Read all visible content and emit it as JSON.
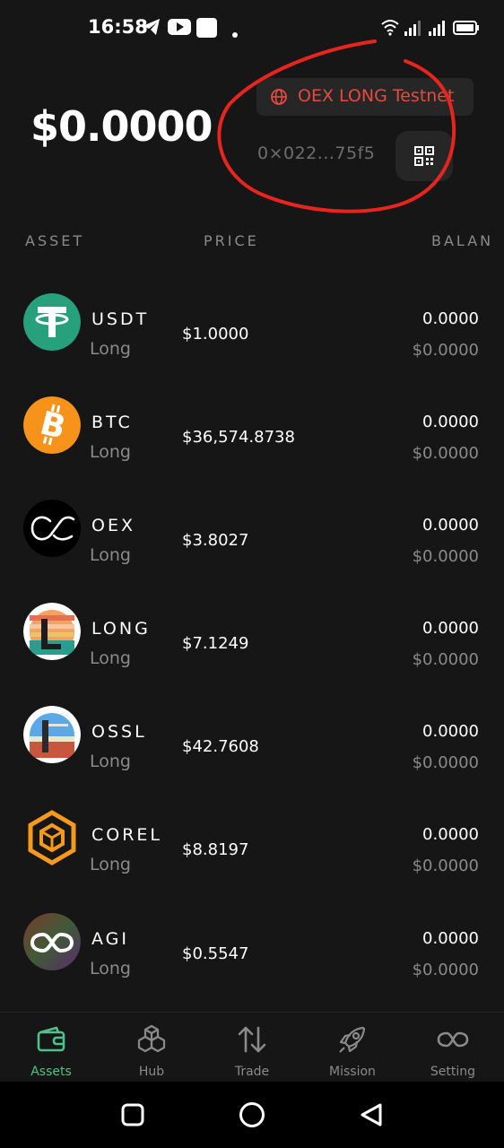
{
  "status_bar": {
    "time": "16:58",
    "icons": [
      "telegram-icon",
      "youtube-icon",
      "app-icon",
      "dot-icon",
      "wifi-icon",
      "signal-icon",
      "signal-icon",
      "battery-icon"
    ]
  },
  "header": {
    "total_balance": "$0.0000",
    "network_label": "OEX LONG Testnet",
    "address": "0×022...75f5",
    "accent_color": "#e8493f"
  },
  "table": {
    "columns": [
      "ASSET",
      "PRICE",
      "BALAN"
    ]
  },
  "assets": [
    {
      "symbol": "USDT",
      "network": "Long",
      "price": "$1.0000",
      "balance": "0.0000",
      "balance_usd": "$0.0000",
      "icon": "usdt-icon"
    },
    {
      "symbol": "BTC",
      "network": "Long",
      "price": "$36,574.8738",
      "balance": "0.0000",
      "balance_usd": "$0.0000",
      "icon": "btc-icon"
    },
    {
      "symbol": "OEX",
      "network": "Long",
      "price": "$3.8027",
      "balance": "0.0000",
      "balance_usd": "$0.0000",
      "icon": "oex-icon"
    },
    {
      "symbol": "LONG",
      "network": "Long",
      "price": "$7.1249",
      "balance": "0.0000",
      "balance_usd": "$0.0000",
      "icon": "long-icon"
    },
    {
      "symbol": "OSSL",
      "network": "Long",
      "price": "$42.7608",
      "balance": "0.0000",
      "balance_usd": "$0.0000",
      "icon": "ossl-icon"
    },
    {
      "symbol": "COREL",
      "network": "Long",
      "price": "$8.8197",
      "balance": "0.0000",
      "balance_usd": "$0.0000",
      "icon": "corel-icon"
    },
    {
      "symbol": "AGI",
      "network": "Long",
      "price": "$0.5547",
      "balance": "0.0000",
      "balance_usd": "$0.0000",
      "icon": "agi-icon"
    }
  ],
  "bottom_nav": {
    "items": [
      {
        "label": "Assets",
        "icon": "wallet-icon",
        "active": true
      },
      {
        "label": "Hub",
        "icon": "cubes-icon",
        "active": false
      },
      {
        "label": "Trade",
        "icon": "arrows-updown-icon",
        "active": false
      },
      {
        "label": "Mission",
        "icon": "rocket-icon",
        "active": false
      },
      {
        "label": "Setting",
        "icon": "infinity-icon",
        "active": false
      }
    ],
    "active_color": "#4cc38a"
  }
}
